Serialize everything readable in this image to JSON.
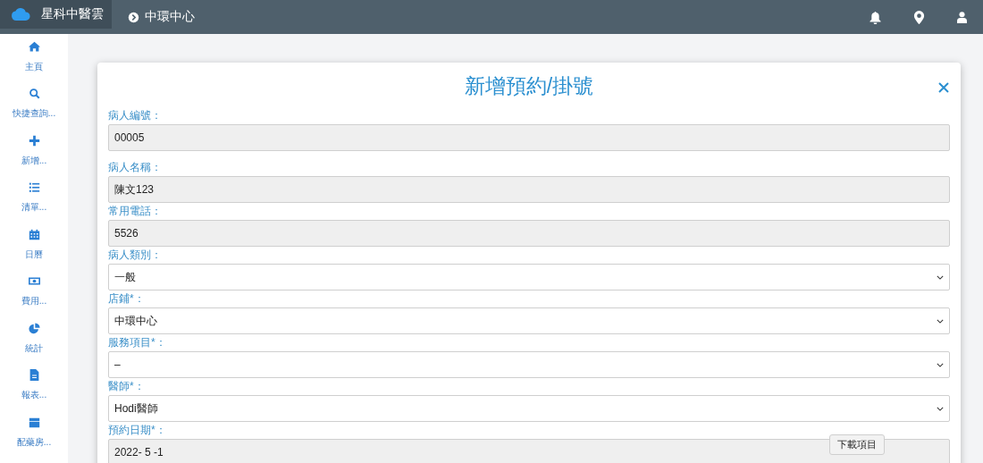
{
  "topbar": {
    "brand": "星科中醫雲",
    "location": "中環中心"
  },
  "sidebar": {
    "items": [
      {
        "label": "主頁"
      },
      {
        "label": "快捷查詢..."
      },
      {
        "label": "新增..."
      },
      {
        "label": "清單..."
      },
      {
        "label": "日曆"
      },
      {
        "label": "費用..."
      },
      {
        "label": "統計"
      },
      {
        "label": "報表..."
      },
      {
        "label": "配藥房..."
      }
    ]
  },
  "dialog": {
    "title": "新增預約/掛號",
    "fields": [
      {
        "label": "病人編號：",
        "kind": "readonly",
        "value": "00005"
      },
      {
        "label": "病人名稱：",
        "kind": "readonly",
        "value": "陳文123"
      },
      {
        "label": "常用電話：",
        "kind": "readonly",
        "value": "5526"
      },
      {
        "label": "病人類別：",
        "kind": "select",
        "value": "一般"
      },
      {
        "label": "店鋪*：",
        "kind": "select",
        "value": "中環中心"
      },
      {
        "label": "服務項目*：",
        "kind": "select",
        "value": "–"
      },
      {
        "label": "醫師*：",
        "kind": "select",
        "value": "Hodi醫師"
      },
      {
        "label": "預約日期*：",
        "kind": "date",
        "value": "2022- 5 -1"
      }
    ]
  },
  "tooltip": "下載項目"
}
